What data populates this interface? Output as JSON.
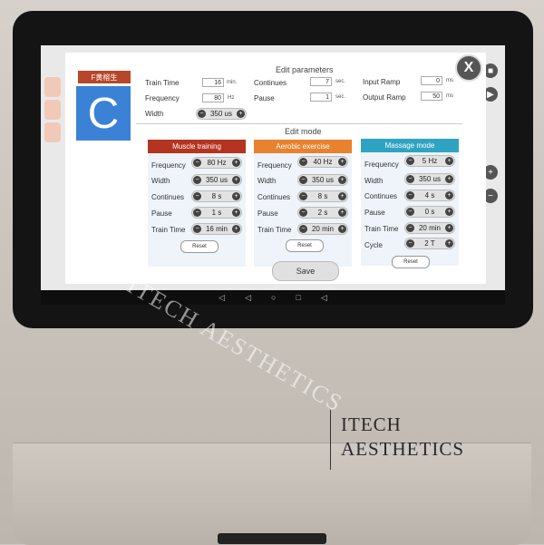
{
  "patient": {
    "name": "F黄榕生",
    "mode_letter": "C"
  },
  "close_label": "X",
  "edit_parameters": {
    "heading": "Edit parameters",
    "train_time": {
      "label": "Train Time",
      "value": "16",
      "unit": "min."
    },
    "frequency": {
      "label": "Frequency",
      "value": "80",
      "unit": "Hz"
    },
    "width": {
      "label": "Width",
      "value": "350 us"
    },
    "continues": {
      "label": "Continues",
      "value": "7",
      "unit": "sec."
    },
    "pause": {
      "label": "Pause",
      "value": "1",
      "unit": "sec."
    },
    "input_ramp": {
      "label": "Input Ramp",
      "value": "0",
      "unit": "ms"
    },
    "output_ramp": {
      "label": "Output Ramp",
      "value": "50",
      "unit": "ms"
    }
  },
  "edit_mode": {
    "heading": "Edit mode",
    "columns": [
      {
        "title": "Muscle training",
        "color": "#b5341f",
        "rows": [
          {
            "label": "Frequency",
            "value": "80 Hz"
          },
          {
            "label": "Width",
            "value": "350 us"
          },
          {
            "label": "Continues",
            "value": "8 s"
          },
          {
            "label": "Pause",
            "value": "1 s"
          },
          {
            "label": "Train Time",
            "value": "16 min"
          }
        ],
        "reset": "Reset"
      },
      {
        "title": "Aerobic exercise",
        "color": "#e8822e",
        "rows": [
          {
            "label": "Frequency",
            "value": "40 Hz"
          },
          {
            "label": "Width",
            "value": "350 us"
          },
          {
            "label": "Continues",
            "value": "8 s"
          },
          {
            "label": "Pause",
            "value": "2 s"
          },
          {
            "label": "Train Time",
            "value": "20 min"
          }
        ],
        "reset": "Reset"
      },
      {
        "title": "Massage mode",
        "color": "#2fa3c2",
        "rows": [
          {
            "label": "Frequency",
            "value": "5 Hz"
          },
          {
            "label": "Width",
            "value": "350 us"
          },
          {
            "label": "Continues",
            "value": "4 s"
          },
          {
            "label": "Pause",
            "value": "0 s"
          },
          {
            "label": "Train Time",
            "value": "20 min"
          },
          {
            "label": "Cycle",
            "value": "2 T"
          }
        ],
        "reset": "Reset"
      }
    ]
  },
  "save_label": "Save",
  "watermark": "ITECH AESTHETICS",
  "branding": {
    "line1": "ITECH",
    "line2": "AESTHETICS"
  },
  "nav": {
    "volume_down": "◁",
    "back": "◁",
    "home": "○",
    "recents": "□",
    "volume_up": "◁"
  }
}
